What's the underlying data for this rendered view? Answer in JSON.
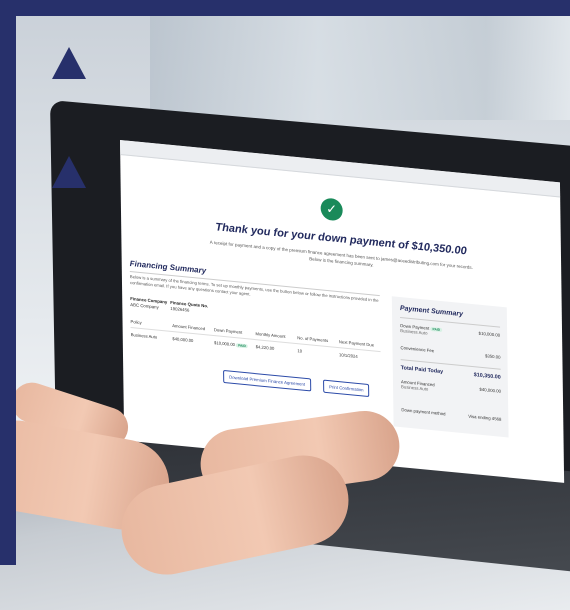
{
  "confirmation": {
    "heading": "Thank you for your down payment of $10,350.00",
    "receipt_line1": "A receipt for payment and a copy of the premium finance agreement has been sent to james@aceedistributing.com for your records.",
    "receipt_line2": "Below is the financing summary."
  },
  "financing_summary": {
    "title": "Financing Summary",
    "description": "Below is a summary of the financing terms. To set up monthly payments, use the button below or follow the instructions provided in the confirmation email. If you have any questions contact your agent.",
    "finance_company_label": "Finance Company",
    "finance_company_value": "ABC Company",
    "quote_no_label": "Finance Quote No.",
    "quote_no_value": "19026456",
    "table": {
      "headers": [
        "Policy",
        "Amount Financed",
        "Down Payment",
        "Monthly Amount",
        "No. of Payments",
        "Next Payment Due"
      ],
      "rows": [
        {
          "policy": "Business Auto",
          "amount_financed": "$40,000.00",
          "down_payment": "$10,000.00",
          "paid_badge": "PAID",
          "monthly_amount": "$4,220.00",
          "payments": "10",
          "next_due": "10/1/2024"
        }
      ]
    },
    "download_label": "Download Premium Finance Agreement",
    "print_label": "Print Confirmation"
  },
  "payment_summary": {
    "title": "Payment Summary",
    "down_payment_label": "Down Payment",
    "paid_badge": "PAID",
    "down_payment_sub": "Business Auto",
    "down_payment_value": "$10,000.00",
    "convenience_fee_label": "Convenience Fee",
    "convenience_fee_value": "$350.00",
    "total_label": "Total Paid Today",
    "total_value": "$10,350.00",
    "amount_financed_label": "Amount Financed",
    "amount_financed_sub": "Business Auto",
    "amount_financed_value": "$40,000.00",
    "method_label": "Down payment method",
    "method_value": "Visa ending 4568"
  },
  "icons": [
    "checkmark-icon"
  ],
  "colors": {
    "navy": "#27306b",
    "success": "#1a8a5a",
    "link": "#2b4aa8"
  }
}
